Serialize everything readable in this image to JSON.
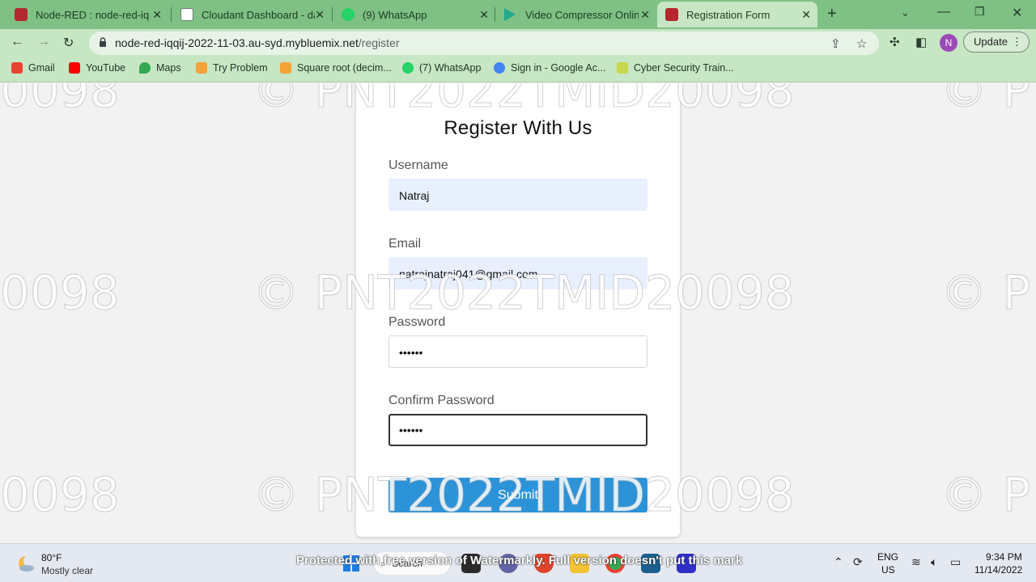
{
  "tabs": [
    {
      "title": "Node-RED : node-red-iqq",
      "favicon_color": "#b3272d"
    },
    {
      "title": "Cloudant Dashboard - dat",
      "favicon_color": "#ffffff"
    },
    {
      "title": "(9) WhatsApp",
      "favicon_color": "#25d366"
    },
    {
      "title": "Video Compressor Online",
      "favicon_color": "#1fa98a"
    },
    {
      "title": "Registration Form",
      "favicon_color": "#b3272d"
    }
  ],
  "address_bar": {
    "host": "node-red-iqqij-2022-11-03.au-syd.mybluemix.net",
    "path": "/register"
  },
  "toolbar": {
    "profile_initial": "N",
    "update_label": "Update"
  },
  "bookmarks": [
    {
      "label": "Gmail",
      "color": "#ea4335"
    },
    {
      "label": "YouTube",
      "color": "#ff0000"
    },
    {
      "label": "Maps",
      "color": "#34a853"
    },
    {
      "label": "Try Problem",
      "color": "#f4a236"
    },
    {
      "label": "Square root (decim...",
      "color": "#f4a236"
    },
    {
      "label": "(7) WhatsApp",
      "color": "#25d366"
    },
    {
      "label": "Sign in - Google Ac...",
      "color": "#4285f4"
    },
    {
      "label": "Cyber Security Train...",
      "color": "#c7d84a"
    }
  ],
  "form": {
    "title": "Register With Us",
    "username_label": "Username",
    "username_value": "Natraj",
    "email_label": "Email",
    "email_value": "natrajnatraj041@gmail.com",
    "password_label": "Password",
    "password_value": "••••••",
    "confirm_label": "Confirm Password",
    "confirm_value": "••••••",
    "submit_label": "Submit",
    "accent_color": "#2d93d8"
  },
  "watermark": {
    "text": "© PNT2022TMID20098",
    "partial_left": "0098",
    "partial_right": "© P",
    "bottom_text": "Protected with free version of Watermarkly. Full version doesn't put this mark"
  },
  "taskbar": {
    "temperature": "80°F",
    "weather": "Mostly clear",
    "search_label": "Search",
    "lang_line1": "ENG",
    "lang_line2": "US",
    "time": "9:34 PM",
    "date": "11/14/2022"
  }
}
